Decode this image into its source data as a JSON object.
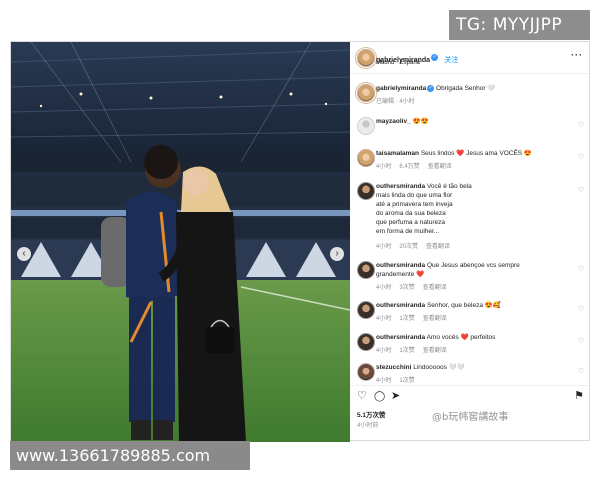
{
  "watermarks": {
    "top": "TG: MYYJJPP",
    "bottom": "www.13661789885.com",
    "overlay": "@b玩帏窖講故事"
  },
  "post": {
    "username": "gabrielymiranda",
    "follow_label": "关注",
    "location": "Madrid · España",
    "caption": "Obrigada Senhor 🤍",
    "caption_meta": "已编辑 · 4小时",
    "likes": "5.1万次赞",
    "time_ago": "4小时前"
  },
  "comments": [
    {
      "user": "mayzaoliv_",
      "text": "😍😍",
      "meta": []
    },
    {
      "user": "taisamalaman",
      "text": "Seus lindos ❤️ Jesus ama VOCÊS 😍",
      "meta": [
        "4小时",
        "6.4万赞",
        "查看翻译"
      ]
    },
    {
      "user": "outhersmiranda",
      "text": "Você é tão bela\nmais linda do que uma flor\naté a primavera tem inveja\ndo aroma da sua beleza\nque perfuma a natureza\nem forma de mulher...",
      "meta": [
        "4小时",
        "20次赞",
        "查看翻译"
      ]
    },
    {
      "user": "outhersmiranda",
      "text": "Que Jesus abençoe vcs sempre grandemente ❤️",
      "meta": [
        "4小时",
        "3次赞",
        "查看翻译"
      ]
    },
    {
      "user": "outhersmiranda",
      "text": "Senhor, que beleza 😍🥰",
      "meta": [
        "4小时",
        "1次赞",
        "查看翻译"
      ]
    },
    {
      "user": "outhersmiranda",
      "text": "Amo vocês ❤️ perfeitos",
      "meta": [
        "4小时",
        "1次赞",
        "查看翻译"
      ]
    },
    {
      "user": "stezucchini",
      "text": "Lindooooos 🤍🤍",
      "meta": [
        "4小时",
        "1次赞"
      ]
    }
  ],
  "icons": {
    "like": "heart-icon",
    "comment": "comment-icon",
    "share": "share-icon",
    "save": "bookmark-icon",
    "more": "more-icon"
  },
  "colors": {
    "link": "#0095f6",
    "verified": "#3897f0",
    "heart": "#ed4956"
  }
}
